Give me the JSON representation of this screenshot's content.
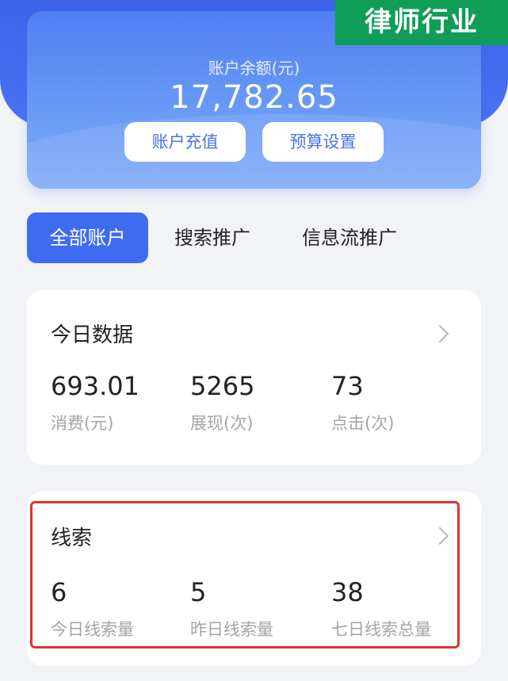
{
  "industry_tag": "律师行业",
  "account": {
    "balance_label": "账户余额(元)",
    "balance_value": "17,782.65",
    "recharge_label": "账户充值",
    "budget_label": "预算设置"
  },
  "tabs": [
    {
      "label": "全部账户",
      "active": true
    },
    {
      "label": "搜索推广",
      "active": false
    },
    {
      "label": "信息流推广",
      "active": false
    }
  ],
  "today": {
    "title": "今日数据",
    "stats": [
      {
        "value": "693.01",
        "label": "消费(元)"
      },
      {
        "value": "5265",
        "label": "展现(次)"
      },
      {
        "value": "73",
        "label": "点击(次)"
      }
    ]
  },
  "leads": {
    "title": "线索",
    "stats": [
      {
        "value": "6",
        "label": "今日线索量"
      },
      {
        "value": "5",
        "label": "昨日线索量"
      },
      {
        "value": "38",
        "label": "七日线索总量"
      }
    ]
  },
  "colors": {
    "primary_blue": "#3d6cf0",
    "tag_green": "#0f9d58",
    "highlight_red": "#e0322d"
  }
}
